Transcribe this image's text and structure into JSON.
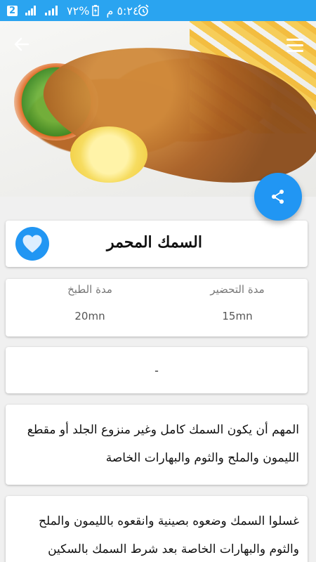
{
  "status_bar": {
    "time": "٥:٢٤ م",
    "battery": "%٧٢",
    "sim_badge": "2",
    "bg_color": "#2aa4f0"
  },
  "hero": {
    "image_alt": "fried-fish-with-fries-and-lemon"
  },
  "recipe": {
    "title": "السمك المحمر",
    "prep_label": "مدة التحضير",
    "prep_value": "15mn",
    "cook_label": "مدة الطبخ",
    "cook_value": "20mn",
    "note": "-",
    "steps": [
      "المهم أن يكون السمك كامل وغير منزوع الجلد أو مقطع الليمون والملح والثوم والبهارات الخاصة",
      "غسلوا السمك وضعوه بصينية وانقعوه بالليمون والملح والثوم والبهارات الخاصة بعد شرط السمك بالسكين"
    ]
  },
  "icons": {
    "back": "arrow-back-icon",
    "menu": "hamburger-menu-icon",
    "share": "share-icon",
    "favorite": "heart-icon",
    "alarm": "alarm-clock-icon",
    "signal": "signal-icon"
  },
  "colors": {
    "accent": "#2196f3",
    "status_bar": "#2aa4f0",
    "background": "#f0f0f0",
    "card": "#ffffff"
  }
}
